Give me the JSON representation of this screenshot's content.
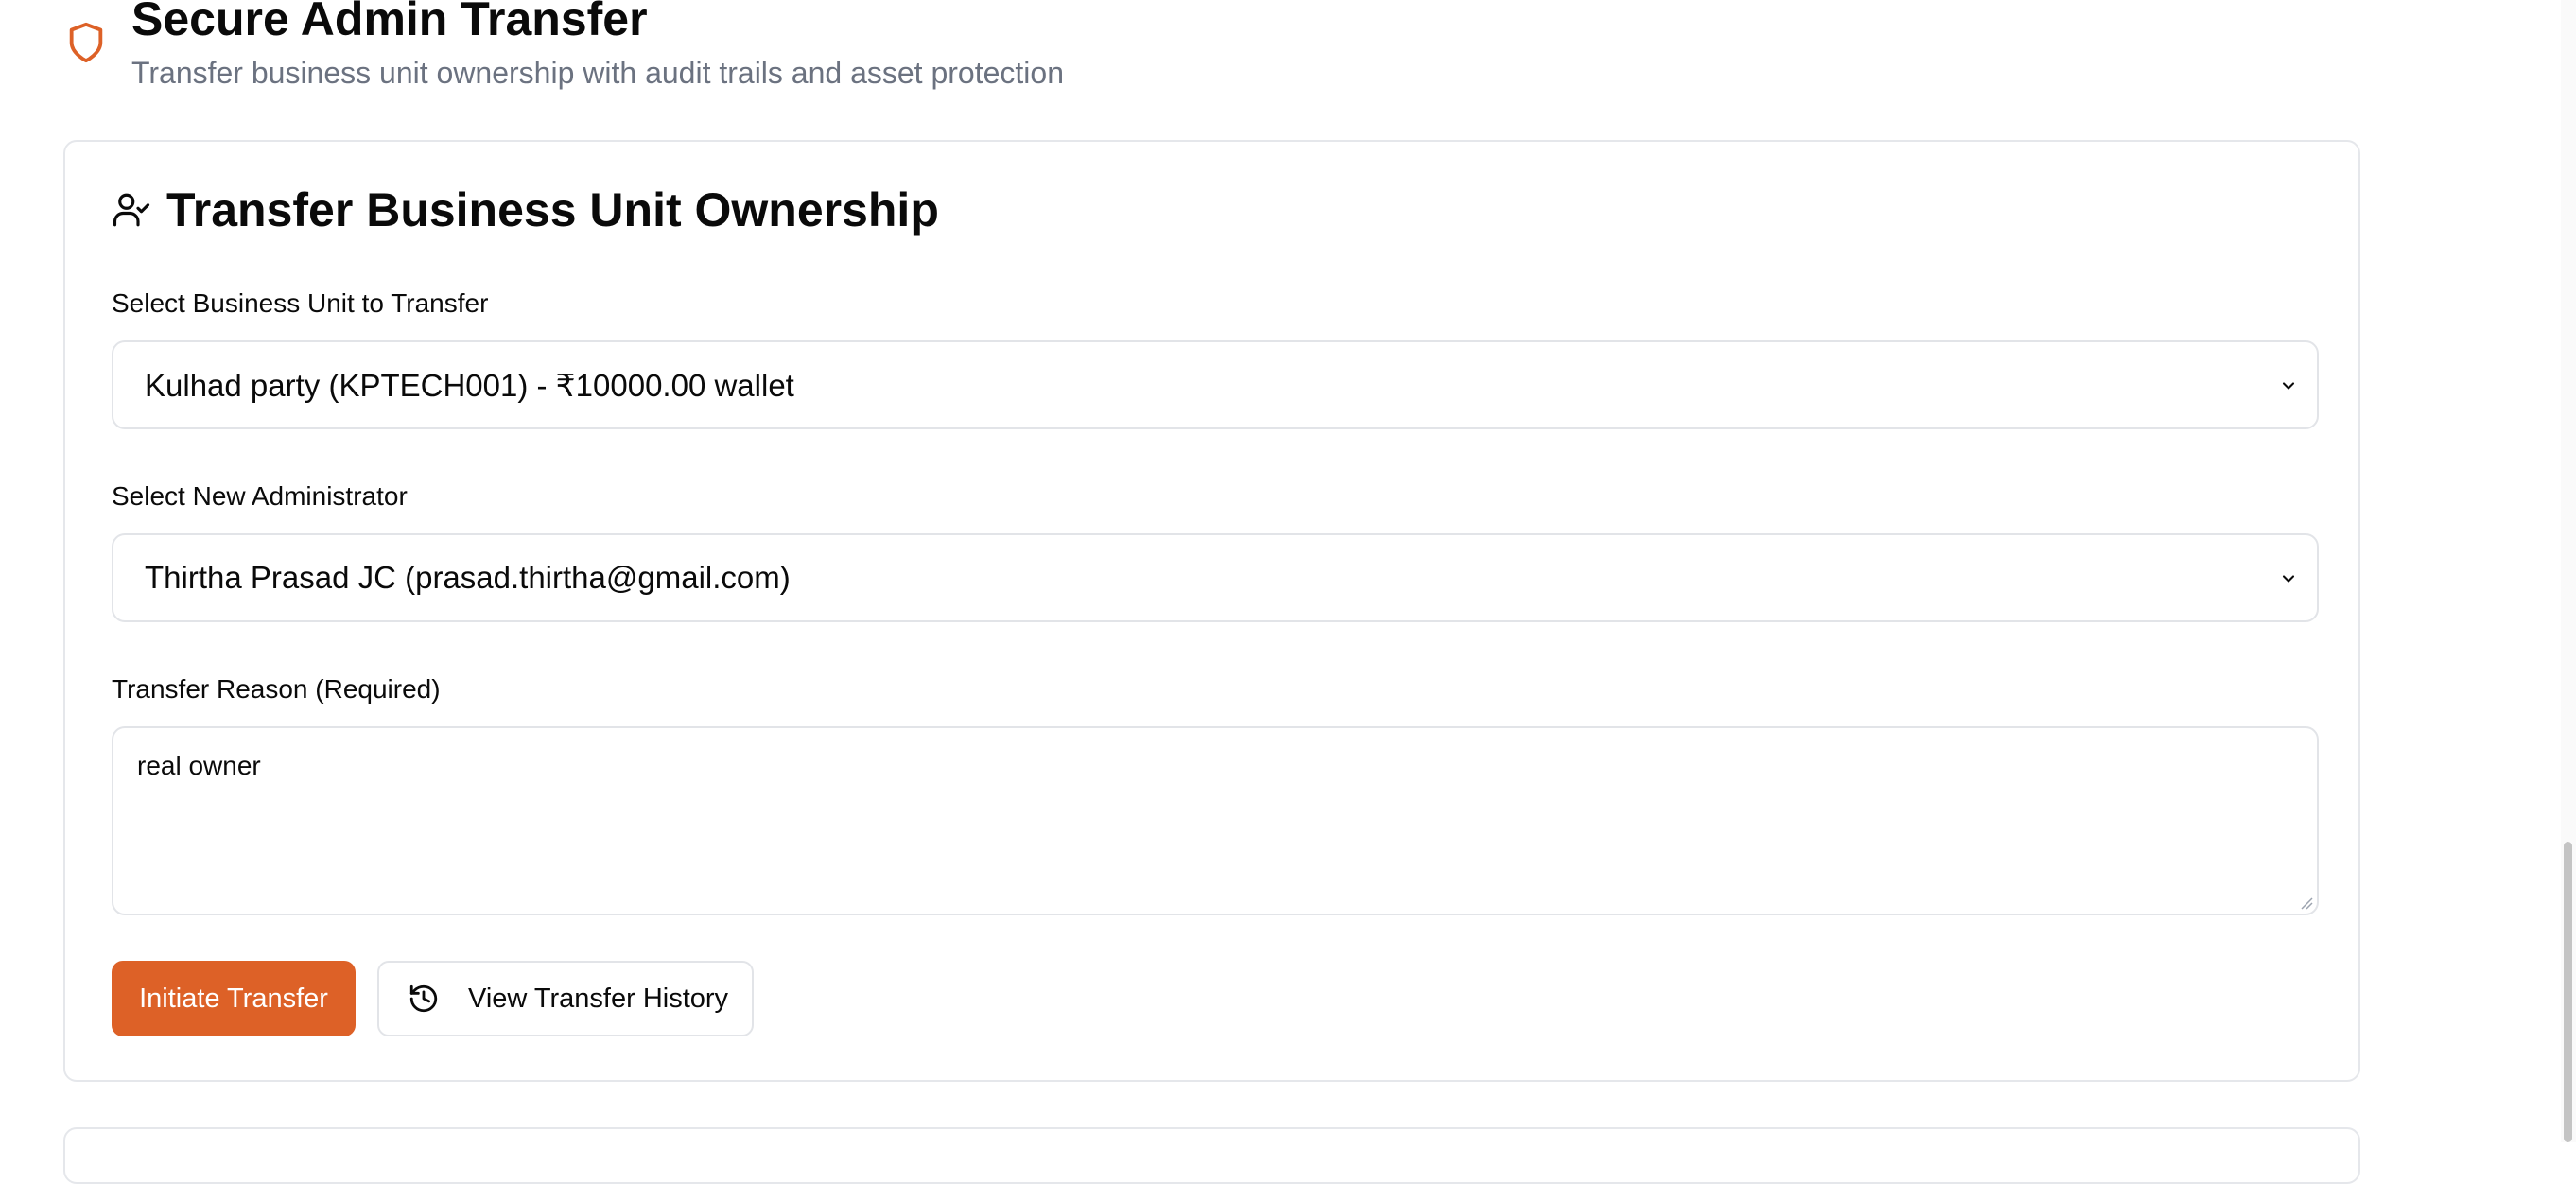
{
  "header": {
    "title": "Secure Admin Transfer",
    "subtitle": "Transfer business unit ownership with audit trails and asset protection",
    "icon": "shield-icon"
  },
  "card": {
    "title": "Transfer Business Unit Ownership",
    "icon": "user-check-icon",
    "business_unit": {
      "label": "Select Business Unit to Transfer",
      "value": "Kulhad party (KPTECH001) - ₹10000.00 wallet"
    },
    "administrator": {
      "label": "Select New Administrator",
      "value": "Thirtha Prasad JC (prasad.thirtha@gmail.com)"
    },
    "reason": {
      "label": "Transfer Reason (Required)",
      "value": "real owner"
    },
    "actions": {
      "initiate_label": "Initiate Transfer",
      "history_label": "View Transfer History",
      "history_icon": "history-icon"
    }
  },
  "colors": {
    "accent": "#dd6127",
    "muted_text": "#6b7280",
    "border": "#e5e7eb"
  }
}
